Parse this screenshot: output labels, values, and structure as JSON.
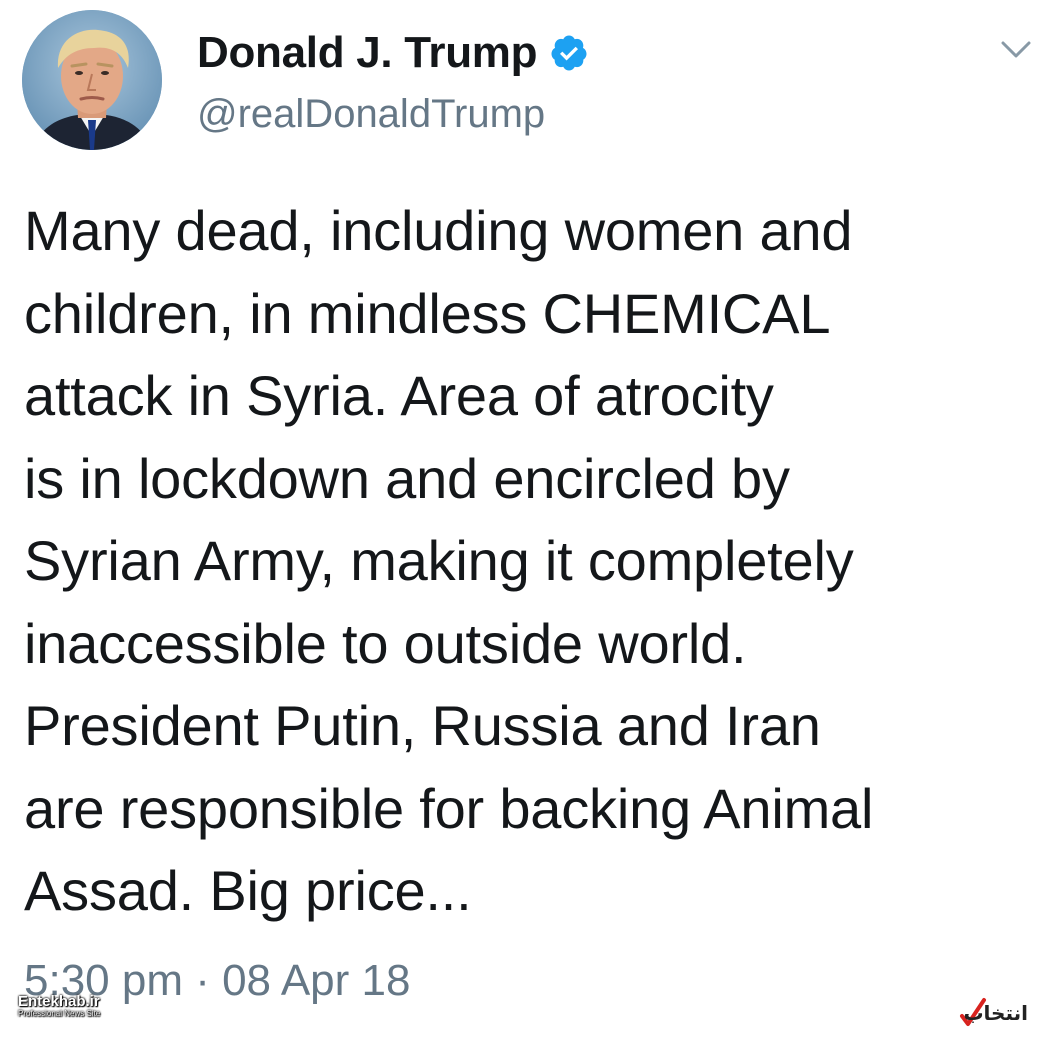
{
  "profile": {
    "display_name": "Donald J. Trump",
    "handle": "@realDonaldTrump",
    "avatar_icon": "profile-photo",
    "verified_icon": "verified-badge-icon",
    "verified_color": "#1da1f2"
  },
  "menu": {
    "icon": "chevron-down-icon"
  },
  "tweet": {
    "lines": [
      "Many dead, including women and",
      "children, in mindless CHEMICAL",
      "attack in Syria. Area of atrocity",
      "is in lockdown and encircled by",
      "Syrian Army, making it completely",
      "inaccessible to outside world.",
      "President Putin, Russia and Iran",
      "are responsible for backing Animal",
      "Assad. Big price..."
    ],
    "timestamp": "5:30 pm · 08 Apr 18"
  },
  "watermark": {
    "left_text": "Entekhab.ir",
    "left_subtext": "Professional News Site",
    "right_text": "انتخاب",
    "accent": "#d8231f"
  },
  "colors": {
    "text": "#14171a",
    "secondary": "#657786",
    "background": "#ffffff"
  }
}
